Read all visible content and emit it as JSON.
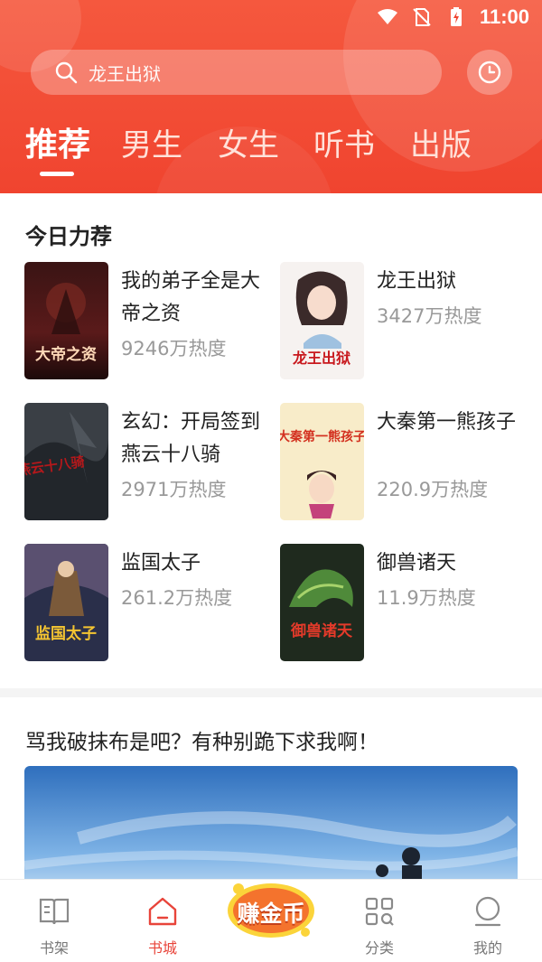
{
  "status_bar": {
    "time": "11:00"
  },
  "search": {
    "placeholder": "龙王出狱"
  },
  "tabs": [
    {
      "label": "推荐",
      "active": true
    },
    {
      "label": "男生"
    },
    {
      "label": "女生"
    },
    {
      "label": "听书"
    },
    {
      "label": "出版"
    }
  ],
  "recommend": {
    "title": "今日力荐",
    "books": [
      {
        "title": "我的弟子全是大帝之资",
        "heat": "9246万热度",
        "cover_text": "大帝之资"
      },
      {
        "title": "龙王出狱",
        "heat": "3427万热度",
        "cover_text": "龙王出狱"
      },
      {
        "title": "玄幻：开局签到燕云十八骑",
        "heat": "2971万热度",
        "cover_text": "燕云十八骑"
      },
      {
        "title": "大秦第一熊孩子",
        "heat": "220.9万热度",
        "cover_text": "大秦第一熊孩子"
      },
      {
        "title": "监国太子",
        "heat": "261.2万热度",
        "cover_text": "监国太子"
      },
      {
        "title": "御兽诸天",
        "heat": "11.9万热度",
        "cover_text": "御兽诸天"
      }
    ]
  },
  "article": {
    "title": "骂我破抹布是吧？有种别跪下求我啊！"
  },
  "bottom_nav": {
    "items": [
      {
        "label": "书架",
        "icon": "bookshelf-icon"
      },
      {
        "label": "书城",
        "icon": "store-icon",
        "active": true
      },
      {
        "label": "赚金币",
        "icon": "earn-coin-icon"
      },
      {
        "label": "分类",
        "icon": "category-icon"
      },
      {
        "label": "我的",
        "icon": "profile-icon"
      }
    ]
  },
  "colors": {
    "accent": "#f0442f",
    "active_nav": "#e8443a",
    "heat_text": "#999999"
  }
}
